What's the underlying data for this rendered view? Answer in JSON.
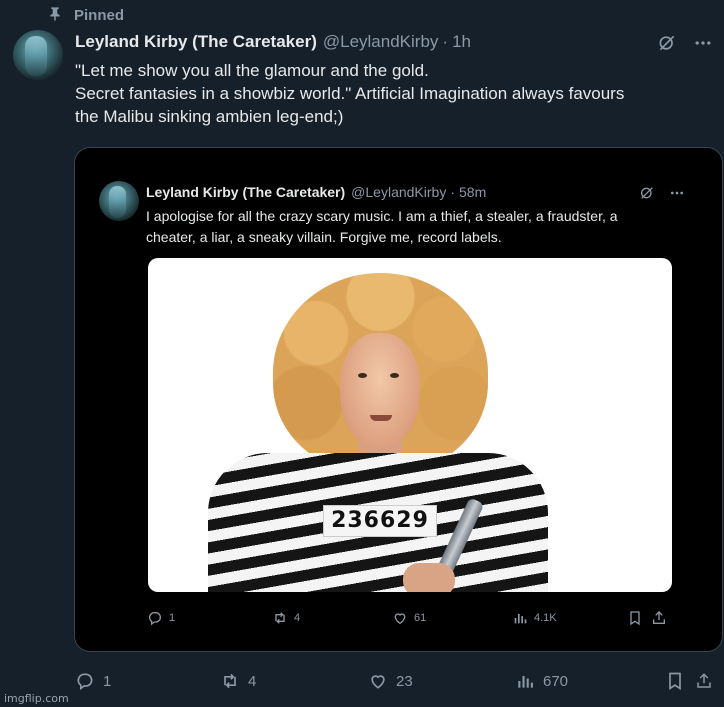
{
  "pinned": {
    "label": "Pinned"
  },
  "tweet": {
    "display_name": "Leyland Kirby (The Caretaker)",
    "handle": "@LeylandKirby",
    "time": "1h",
    "text_lines": [
      "\"Let me show you all the glamour and the gold.",
      "Secret fantasies in a showbiz world.\" Artificial Imagination always favours",
      "the Malibu sinking ambien leg-end;)"
    ],
    "actions": {
      "replies": "1",
      "reposts": "4",
      "likes": "23",
      "views": "670"
    }
  },
  "quoted_screenshot": {
    "display_name": "Leyland Kirby (The Caretaker)",
    "handle": "@LeylandKirby",
    "time": "58m",
    "text_lines": [
      "I apologise for all the crazy scary music. I am a thief, a stealer, a fraudster, a",
      "cheater, a liar, a sneaky villain. Forgive me, record labels."
    ],
    "prisoner_number": "236629",
    "actions": {
      "replies": "1",
      "reposts": "4",
      "likes": "61",
      "views": "4.1K"
    }
  },
  "watermark": "imgflip.com",
  "icons": {
    "pin": "pin-icon",
    "grok": "grok-icon",
    "more": "more-icon",
    "reply": "reply-icon",
    "repost": "repost-icon",
    "like": "like-icon",
    "views": "views-icon",
    "bookmark": "bookmark-icon",
    "share": "share-icon"
  },
  "colors": {
    "background": "#15202b",
    "text": "#e7e9ea",
    "muted": "#8b98a5",
    "border": "#38444d"
  }
}
